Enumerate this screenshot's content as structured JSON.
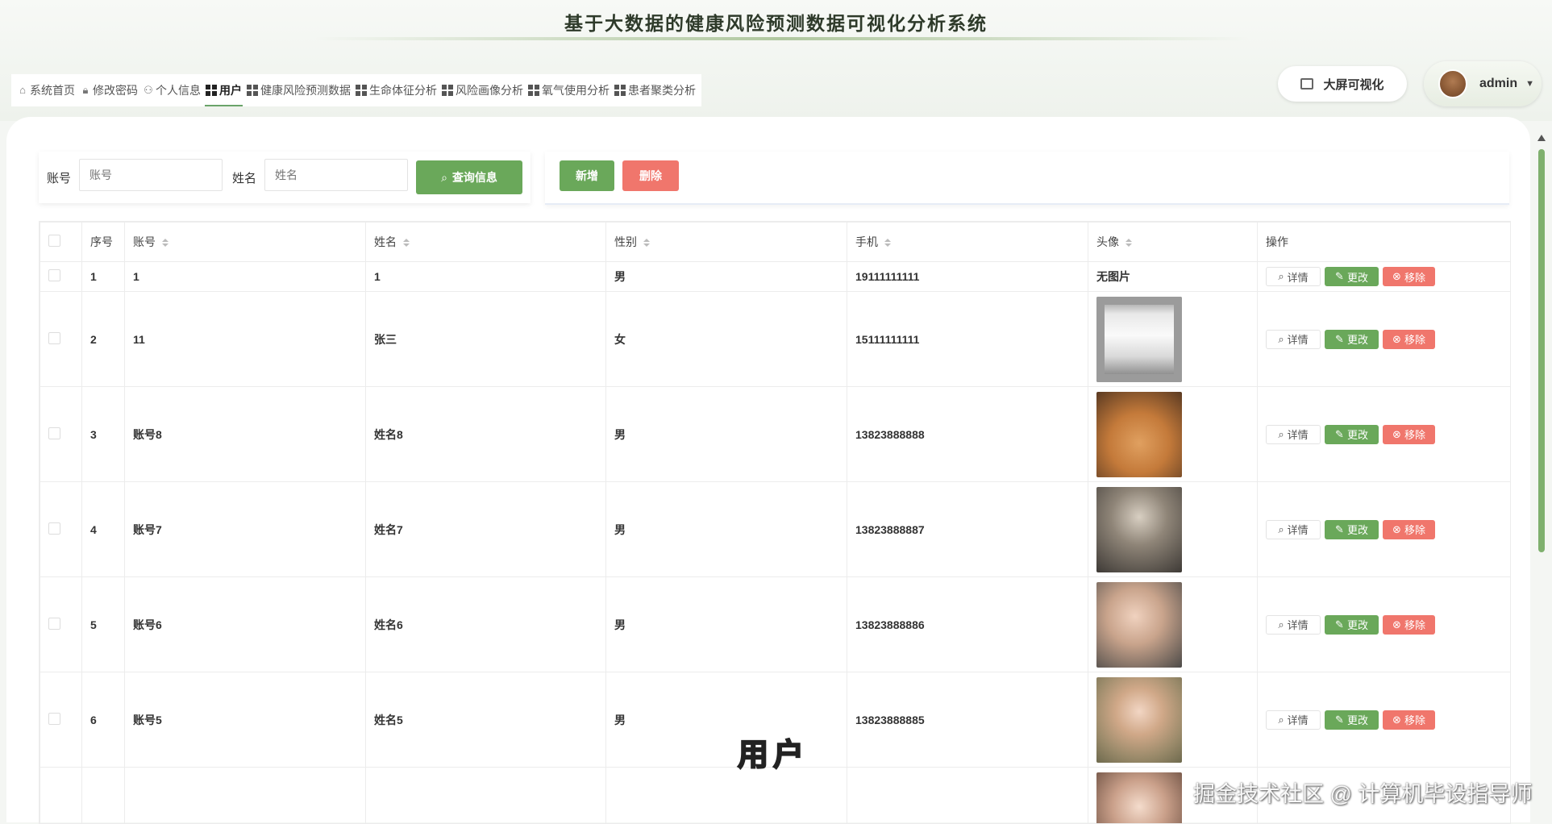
{
  "app": {
    "title": "基于大数据的健康风险预测数据可视化分析系统"
  },
  "nav": {
    "items": [
      {
        "label": "系统首页",
        "icon": "home-icon"
      },
      {
        "label": "修改密码",
        "icon": "lock-icon"
      },
      {
        "label": "个人信息",
        "icon": "user-icon"
      },
      {
        "label": "用户",
        "icon": "grid-icon",
        "active": true
      },
      {
        "label": "健康风险预测数据",
        "icon": "grid-icon"
      },
      {
        "label": "生命体征分析",
        "icon": "grid-icon"
      },
      {
        "label": "风险画像分析",
        "icon": "grid-icon"
      },
      {
        "label": "氧气使用分析",
        "icon": "grid-icon"
      },
      {
        "label": "患者聚类分析",
        "icon": "grid-icon"
      }
    ]
  },
  "header": {
    "bigscreen_label": "大屏可视化",
    "username": "admin"
  },
  "search": {
    "account_label": "账号",
    "account_placeholder": "账号",
    "name_label": "姓名",
    "name_placeholder": "姓名",
    "query_label": "查询信息"
  },
  "actions": {
    "add_label": "新增",
    "delete_label": "删除"
  },
  "table": {
    "columns": [
      "序号",
      "账号",
      "姓名",
      "性别",
      "手机",
      "头像",
      "操作"
    ],
    "rows": [
      {
        "index": "1",
        "account": "1",
        "name": "1",
        "gender": "男",
        "phone": "19111111111",
        "avatar_text": "无图片"
      },
      {
        "index": "2",
        "account": "11",
        "name": "张三",
        "gender": "女",
        "phone": "15111111111",
        "avatar_text": ""
      },
      {
        "index": "3",
        "account": "账号8",
        "name": "姓名8",
        "gender": "男",
        "phone": "13823888888",
        "avatar_text": ""
      },
      {
        "index": "4",
        "account": "账号7",
        "name": "姓名7",
        "gender": "男",
        "phone": "13823888887",
        "avatar_text": ""
      },
      {
        "index": "5",
        "account": "账号6",
        "name": "姓名6",
        "gender": "男",
        "phone": "13823888886",
        "avatar_text": ""
      },
      {
        "index": "6",
        "account": "账号5",
        "name": "姓名5",
        "gender": "男",
        "phone": "13823888885",
        "avatar_text": ""
      }
    ],
    "row_actions": {
      "detail": "详情",
      "edit": "更改",
      "remove": "移除"
    }
  },
  "overlay": {
    "subtitle": "用户",
    "watermark": "掘金技术社区 @ 计算机毕设指导师"
  },
  "colors": {
    "accent": "#6aa85a",
    "danger": "#f0766c"
  }
}
